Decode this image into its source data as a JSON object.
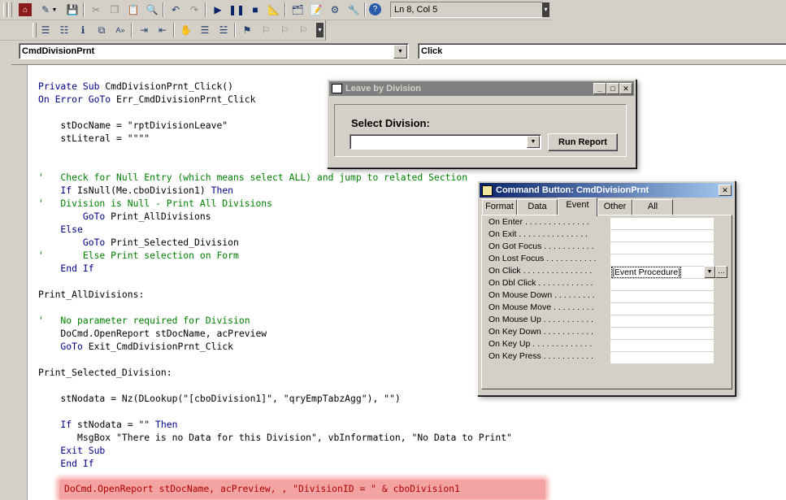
{
  "toolbar1": {
    "icons": [
      "access-view-icon",
      "insert-module-icon",
      "save-icon",
      "cut-icon",
      "copy-icon",
      "paste-icon",
      "find-icon",
      "undo-icon",
      "redo-icon",
      "run-icon",
      "break-icon",
      "reset-icon",
      "design-mode-icon",
      "project-explorer-icon",
      "properties-icon",
      "object-browser-icon",
      "toolbox-icon",
      "help-icon"
    ],
    "position_status": "Ln 8, Col 5"
  },
  "toolbar2": {
    "icons": [
      "list-properties-icon",
      "list-constants-icon",
      "quick-info-icon",
      "parameter-info-icon",
      "complete-word-icon",
      "indent-icon",
      "outdent-icon",
      "toggle-breakpoint-icon",
      "comment-block-icon",
      "uncomment-block-icon",
      "toggle-bookmark-icon",
      "next-bookmark-icon",
      "previous-bookmark-icon",
      "clear-bookmarks-icon"
    ]
  },
  "object_combo": "CmdDivisionPrnt",
  "procedure_combo": "Click",
  "code_lines": [
    {
      "type": "mixed",
      "parts": [
        [
          "kw",
          "Private Sub "
        ],
        [
          "n",
          "CmdDivisionPrnt_Click()"
        ]
      ]
    },
    {
      "type": "mixed",
      "parts": [
        [
          "kw",
          "On Error GoTo "
        ],
        [
          "n",
          "Err_CmdDivisionPrnt_Click"
        ]
      ]
    },
    {
      "type": "blank"
    },
    {
      "type": "mixed",
      "parts": [
        [
          "n",
          "    stDocName = \"rptDivisionLeave\""
        ]
      ]
    },
    {
      "type": "mixed",
      "parts": [
        [
          "n",
          "    stLiteral = \"\"\"\""
        ]
      ]
    },
    {
      "type": "blank"
    },
    {
      "type": "blank"
    },
    {
      "type": "mixed",
      "parts": [
        [
          "cm",
          "'   Check for Null Entry (which means select ALL) and jump to related Section"
        ]
      ]
    },
    {
      "type": "mixed",
      "parts": [
        [
          "kw",
          "    If "
        ],
        [
          "n",
          "IsNull(Me.cboDivision1) "
        ],
        [
          "kw",
          "Then"
        ]
      ]
    },
    {
      "type": "mixed",
      "parts": [
        [
          "cm",
          "'   Division is Null - Print All Divisions"
        ]
      ]
    },
    {
      "type": "mixed",
      "parts": [
        [
          "kw",
          "        GoTo "
        ],
        [
          "n",
          "Print_AllDivisions"
        ]
      ]
    },
    {
      "type": "mixed",
      "parts": [
        [
          "kw",
          "    Else"
        ]
      ]
    },
    {
      "type": "mixed",
      "parts": [
        [
          "kw",
          "        GoTo "
        ],
        [
          "n",
          "Print_Selected_Division"
        ]
      ]
    },
    {
      "type": "mixed",
      "parts": [
        [
          "cm",
          "'       Else Print selection on Form"
        ]
      ]
    },
    {
      "type": "mixed",
      "parts": [
        [
          "kw",
          "    End If"
        ]
      ]
    },
    {
      "type": "blank"
    },
    {
      "type": "mixed",
      "parts": [
        [
          "n",
          "Print_AllDivisions:"
        ]
      ]
    },
    {
      "type": "blank"
    },
    {
      "type": "mixed",
      "parts": [
        [
          "cm",
          "'   No parameter required for Division"
        ]
      ]
    },
    {
      "type": "mixed",
      "parts": [
        [
          "n",
          "    DoCmd.OpenReport stDocName, acPreview"
        ]
      ]
    },
    {
      "type": "mixed",
      "parts": [
        [
          "kw",
          "    GoTo "
        ],
        [
          "n",
          "Exit_CmdDivisionPrnt_Click"
        ]
      ]
    },
    {
      "type": "blank"
    },
    {
      "type": "mixed",
      "parts": [
        [
          "n",
          "Print_Selected_Division:"
        ]
      ]
    },
    {
      "type": "blank"
    },
    {
      "type": "mixed",
      "parts": [
        [
          "n",
          "    stNodata = Nz(DLookup(\"[cboDivision1]\", \"qryEmpTabzAgg\"), \"\")"
        ]
      ]
    },
    {
      "type": "blank"
    },
    {
      "type": "mixed",
      "parts": [
        [
          "kw",
          "    If "
        ],
        [
          "n",
          "stNodata = \"\" "
        ],
        [
          "kw",
          "Then"
        ]
      ]
    },
    {
      "type": "mixed",
      "parts": [
        [
          "n",
          "       MsgBox \"There is no Data for this Division\", vbInformation, \"No Data to Print\""
        ]
      ]
    },
    {
      "type": "mixed",
      "parts": [
        [
          "kw",
          "    Exit Sub"
        ]
      ]
    },
    {
      "type": "mixed",
      "parts": [
        [
          "kw",
          "    End If"
        ]
      ]
    }
  ],
  "highlighted_line": "DoCmd.OpenReport stDocName, acPreview, , \"DivisionID = \" & cboDivision1",
  "colors": {
    "highlight": "#f4a3a3",
    "highlight_text": "#b00000",
    "keyword": "#00008b",
    "comment": "#008000"
  },
  "leave_window": {
    "title": "Leave by Division",
    "label": "Select Division:",
    "combo_value": "",
    "run_button": "Run Report"
  },
  "prop_window": {
    "title": "Command Button: CmdDivisionPrnt",
    "tabs": [
      "Format",
      "Data",
      "Event",
      "Other",
      "All"
    ],
    "active_tab": "Event",
    "rows": [
      {
        "label": "On Enter . . . . . . . . . . . . . .",
        "value": ""
      },
      {
        "label": "On Exit . . . . . . . . . . . . . . .",
        "value": ""
      },
      {
        "label": "On Got Focus . . . . . . . . . . .",
        "value": ""
      },
      {
        "label": "On Lost Focus . . . . . . . . . . .",
        "value": ""
      },
      {
        "label": "On Click . . . . . . . . . . . . . . .",
        "value": "[Event Procedure]"
      },
      {
        "label": "On Dbl Click . . . . . . . . . . . .",
        "value": ""
      },
      {
        "label": "On Mouse Down . . . . . . . . .",
        "value": ""
      },
      {
        "label": "On Mouse Move . . . . . . . . .",
        "value": ""
      },
      {
        "label": "On Mouse Up . . . . . . . . . . .",
        "value": ""
      },
      {
        "label": "On Key Down . . . . . . . . . . .",
        "value": ""
      },
      {
        "label": "On Key Up . . . . . . . . . . . . .",
        "value": ""
      },
      {
        "label": "On Key Press . . . . . . . . . . .",
        "value": ""
      }
    ]
  }
}
